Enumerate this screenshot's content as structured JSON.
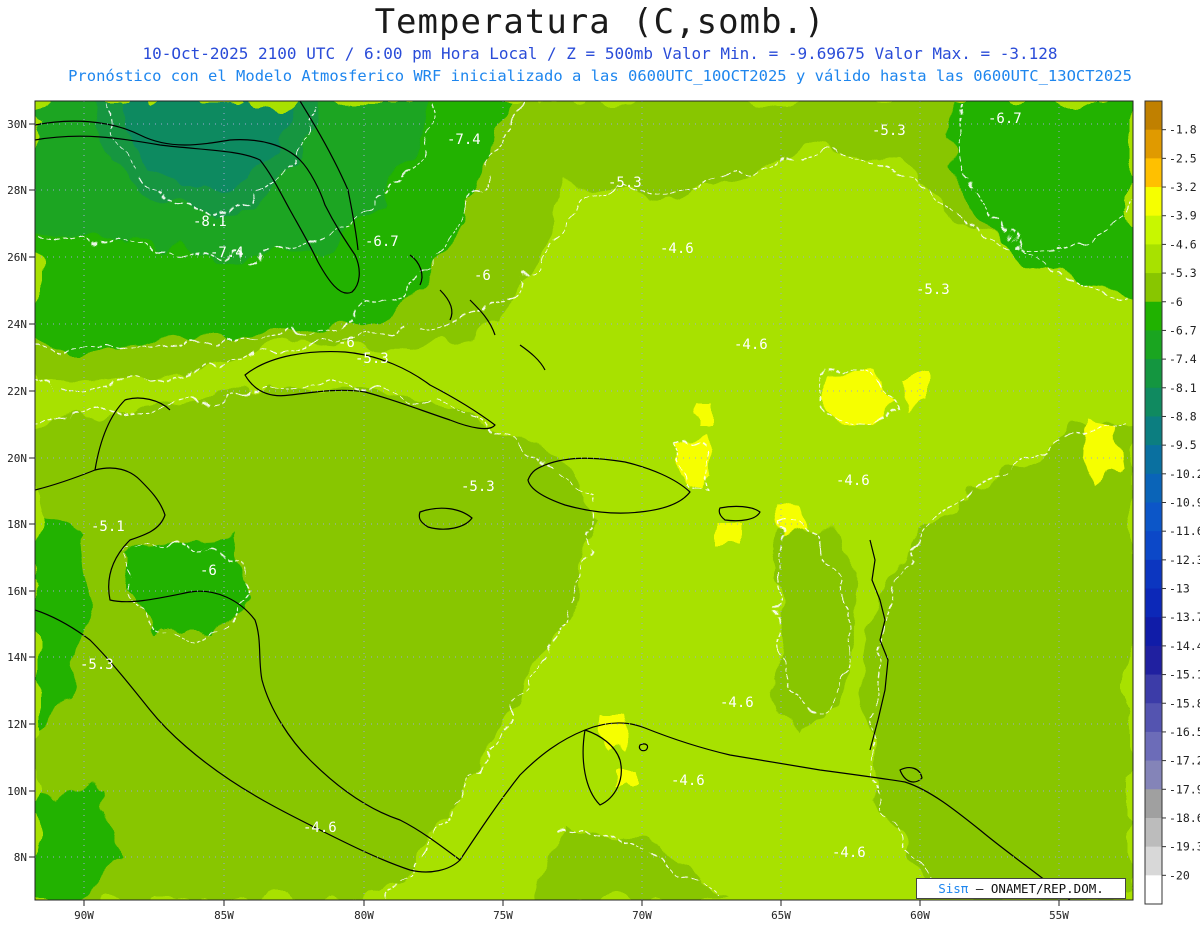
{
  "header": {
    "title": "Temperatura (C,somb.)",
    "line1": "10-Oct-2025  2100 UTC / 6:00 pm Hora Local / Z = 500mb   Valor Min. = -9.69675  Valor Max. = -3.128",
    "line2": "Pronóstico con el Modelo Atmosferico WRF inicializado a las 0600UTC_10OCT2025 y válido hasta las  0600UTC_13OCT2025"
  },
  "map": {
    "x_ticks": [
      "90W",
      "85W",
      "80W",
      "75W",
      "70W",
      "65W",
      "60W",
      "55W"
    ],
    "y_ticks": [
      "30N",
      "28N",
      "26N",
      "24N",
      "22N",
      "20N",
      "18N",
      "16N",
      "14N",
      "12N",
      "10N",
      "8N"
    ],
    "contour_labels": [
      "-7.4",
      "-6.7",
      "-5.3",
      "-8.1",
      "-7.4",
      "-6.7",
      "-6",
      "-5.3",
      "-4.6",
      "-5.3",
      "-4.6",
      "-6",
      "-5.3",
      "-4.6",
      "-5.3",
      "-5.1",
      "-6",
      "-5.3",
      "-4.6",
      "-4.6",
      "-4.6",
      "-4.6"
    ],
    "credit_brand": "Sisπ",
    "credit_org": "– ONAMET/REP.DOM."
  },
  "colorbar": {
    "labels": [
      "-1.8",
      "-2.5",
      "-3.2",
      "-3.9",
      "-4.6",
      "-5.3",
      "-6",
      "-6.7",
      "-7.4",
      "-8.1",
      "-8.8",
      "-9.5",
      "-10.2",
      "-10.9",
      "-11.6",
      "-12.3",
      "-13",
      "-13.7",
      "-14.4",
      "-15.1",
      "-15.8",
      "-16.5",
      "-17.2",
      "-17.9",
      "-18.6",
      "-19.3",
      "-20"
    ],
    "colors": [
      "#c08000",
      "#e09a00",
      "#ffc000",
      "#f6ff00",
      "#c8f700",
      "#a8e100",
      "#88c600",
      "#20b200",
      "#1aa520",
      "#149640",
      "#108a60",
      "#0c7e80",
      "#0a70a0",
      "#0a64b8",
      "#0c56c8",
      "#0c48c8",
      "#0c36c0",
      "#0c28b8",
      "#101ca8",
      "#2020a0",
      "#3c3ca8",
      "#5454b0",
      "#6c6cb8",
      "#8484b8",
      "#a0a0a0",
      "#bcbcbc",
      "#d8d8d8",
      "#ffffff"
    ]
  }
}
